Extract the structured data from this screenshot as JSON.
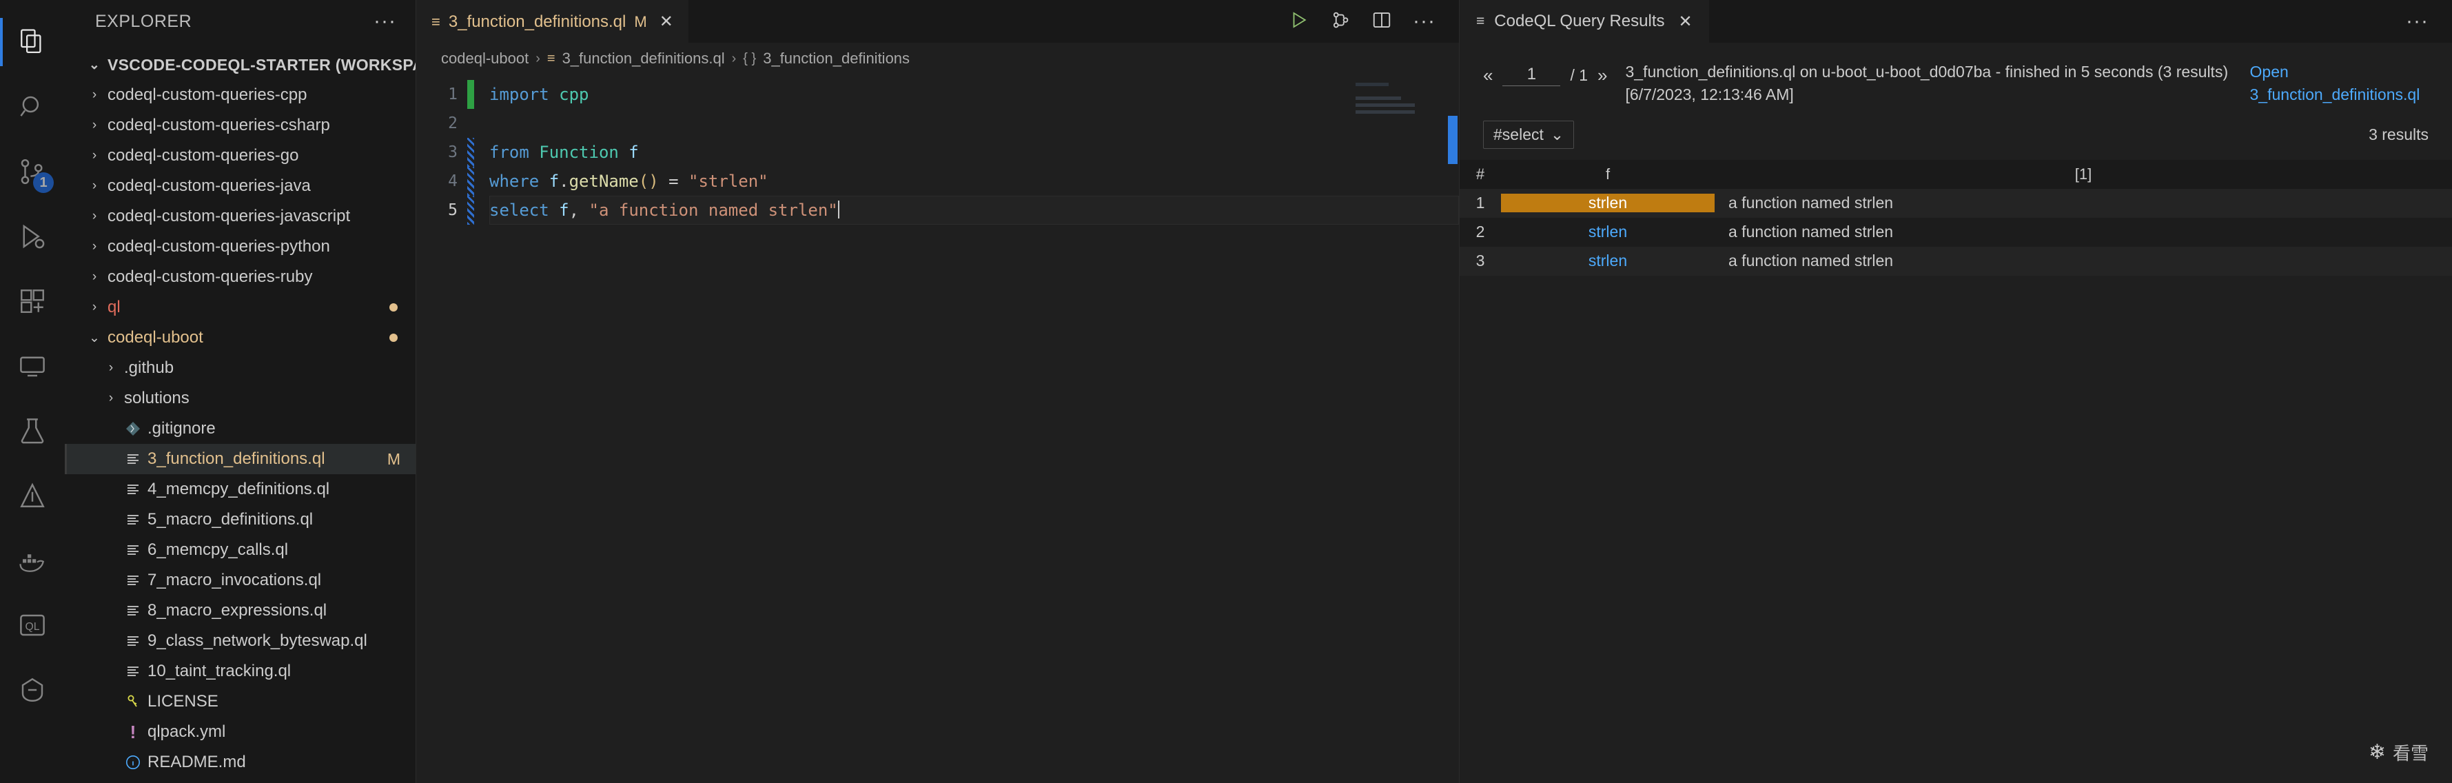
{
  "activity_bar": {
    "items": [
      {
        "name": "explorer",
        "icon": "files-icon",
        "active": true,
        "badge": null
      },
      {
        "name": "search",
        "icon": "search-icon",
        "active": false,
        "badge": null
      },
      {
        "name": "source-control",
        "icon": "source-control-icon",
        "active": false,
        "badge": "1"
      },
      {
        "name": "run-and-debug",
        "icon": "run-debug-icon",
        "active": false,
        "badge": null
      },
      {
        "name": "extensions",
        "icon": "extensions-icon",
        "active": false,
        "badge": null
      },
      {
        "name": "remote-explorer",
        "icon": "remote-explorer-icon",
        "active": false,
        "badge": null
      },
      {
        "name": "testing",
        "icon": "beaker-icon",
        "active": false,
        "badge": null
      },
      {
        "name": "vscode-pets",
        "icon": "triangle-icon",
        "active": false,
        "badge": null
      },
      {
        "name": "docker",
        "icon": "docker-icon",
        "active": false,
        "badge": null
      },
      {
        "name": "codeql",
        "icon": "ql-icon",
        "active": false,
        "badge": null
      },
      {
        "name": "copilot",
        "icon": "copilot-icon",
        "active": false,
        "badge": null
      }
    ]
  },
  "sidebar": {
    "title": "EXPLORER",
    "more_actions": "···",
    "root": {
      "label": "VSCODE-CODEQL-STARTER (WORKSPA...",
      "twisty": "⌄"
    },
    "items": [
      {
        "label": "codeql-custom-queries-cpp",
        "type": "folder",
        "twisty": "›",
        "color": "normal",
        "deco": "",
        "dot": false,
        "selected": false
      },
      {
        "label": "codeql-custom-queries-csharp",
        "type": "folder",
        "twisty": "›",
        "color": "normal",
        "deco": "",
        "dot": false,
        "selected": false
      },
      {
        "label": "codeql-custom-queries-go",
        "type": "folder",
        "twisty": "›",
        "color": "normal",
        "deco": "",
        "dot": false,
        "selected": false
      },
      {
        "label": "codeql-custom-queries-java",
        "type": "folder",
        "twisty": "›",
        "color": "normal",
        "deco": "",
        "dot": false,
        "selected": false
      },
      {
        "label": "codeql-custom-queries-javascript",
        "type": "folder",
        "twisty": "›",
        "color": "normal",
        "deco": "",
        "dot": false,
        "selected": false
      },
      {
        "label": "codeql-custom-queries-python",
        "type": "folder",
        "twisty": "›",
        "color": "normal",
        "deco": "",
        "dot": false,
        "selected": false
      },
      {
        "label": "codeql-custom-queries-ruby",
        "type": "folder",
        "twisty": "›",
        "color": "normal",
        "deco": "",
        "dot": false,
        "selected": false
      },
      {
        "label": "ql",
        "type": "folder",
        "twisty": "›",
        "color": "red",
        "deco": "",
        "dot": true,
        "selected": false
      },
      {
        "label": "codeql-uboot",
        "type": "folder",
        "twisty": "⌄",
        "color": "mod",
        "deco": "",
        "dot": true,
        "selected": false
      },
      {
        "label": ".github",
        "type": "folder",
        "twisty": "›",
        "color": "normal",
        "deco": "",
        "dot": false,
        "selected": false,
        "indent": 1
      },
      {
        "label": "solutions",
        "type": "folder",
        "twisty": "›",
        "color": "normal",
        "deco": "",
        "dot": false,
        "selected": false,
        "indent": 1
      },
      {
        "label": ".gitignore",
        "type": "git",
        "twisty": "",
        "color": "normal",
        "deco": "",
        "dot": false,
        "selected": false,
        "indent": 1
      },
      {
        "label": "3_function_definitions.ql",
        "type": "ql",
        "twisty": "",
        "color": "mod",
        "deco": "M",
        "dot": false,
        "selected": true,
        "indent": 1
      },
      {
        "label": "4_memcpy_definitions.ql",
        "type": "ql",
        "twisty": "",
        "color": "normal",
        "deco": "",
        "dot": false,
        "selected": false,
        "indent": 1
      },
      {
        "label": "5_macro_definitions.ql",
        "type": "ql",
        "twisty": "",
        "color": "normal",
        "deco": "",
        "dot": false,
        "selected": false,
        "indent": 1
      },
      {
        "label": "6_memcpy_calls.ql",
        "type": "ql",
        "twisty": "",
        "color": "normal",
        "deco": "",
        "dot": false,
        "selected": false,
        "indent": 1
      },
      {
        "label": "7_macro_invocations.ql",
        "type": "ql",
        "twisty": "",
        "color": "normal",
        "deco": "",
        "dot": false,
        "selected": false,
        "indent": 1
      },
      {
        "label": "8_macro_expressions.ql",
        "type": "ql",
        "twisty": "",
        "color": "normal",
        "deco": "",
        "dot": false,
        "selected": false,
        "indent": 1
      },
      {
        "label": "9_class_network_byteswap.ql",
        "type": "ql",
        "twisty": "",
        "color": "normal",
        "deco": "",
        "dot": false,
        "selected": false,
        "indent": 1
      },
      {
        "label": "10_taint_tracking.ql",
        "type": "ql",
        "twisty": "",
        "color": "normal",
        "deco": "",
        "dot": false,
        "selected": false,
        "indent": 1
      },
      {
        "label": "LICENSE",
        "type": "license",
        "twisty": "",
        "color": "normal",
        "deco": "",
        "dot": false,
        "selected": false,
        "indent": 1
      },
      {
        "label": "qlpack.yml",
        "type": "yml",
        "twisty": "",
        "color": "normal",
        "deco": "",
        "dot": false,
        "selected": false,
        "indent": 1
      },
      {
        "label": "README.md",
        "type": "md",
        "twisty": "",
        "color": "normal",
        "deco": "",
        "dot": false,
        "selected": false,
        "indent": 1
      }
    ]
  },
  "editor": {
    "tab": {
      "icon": "ql-file-icon",
      "label": "3_function_definitions.ql",
      "modified_badge": "M",
      "close": "✕"
    },
    "actions": [
      "run-query-icon",
      "quick-eval-icon",
      "split-editor-icon",
      "more-actions-icon"
    ],
    "breadcrumb": [
      {
        "label": "codeql-uboot",
        "icon": ""
      },
      {
        "label": "3_function_definitions.ql",
        "icon": "ql-file-icon"
      },
      {
        "label": "3_function_definitions",
        "icon": "braces-icon"
      }
    ],
    "breadcrumb_separator": "›",
    "line_numbers": [
      "1",
      "2",
      "3",
      "4",
      "5"
    ],
    "current_line": 5,
    "code": [
      {
        "n": 1,
        "change": "added",
        "tokens": [
          {
            "t": "import",
            "c": "k-import"
          },
          {
            "t": " ",
            "c": "k-op"
          },
          {
            "t": "cpp",
            "c": "k-mod2"
          }
        ]
      },
      {
        "n": 2,
        "change": "",
        "tokens": []
      },
      {
        "n": 3,
        "change": "modified",
        "tokens": [
          {
            "t": "from",
            "c": "k-kw"
          },
          {
            "t": " ",
            "c": "k-op"
          },
          {
            "t": "Function",
            "c": "k-type"
          },
          {
            "t": " ",
            "c": "k-op"
          },
          {
            "t": "f",
            "c": "k-var"
          }
        ]
      },
      {
        "n": 4,
        "change": "modified",
        "tokens": [
          {
            "t": "where",
            "c": "k-kw"
          },
          {
            "t": " ",
            "c": "k-op"
          },
          {
            "t": "f",
            "c": "k-var"
          },
          {
            "t": ".",
            "c": "k-op"
          },
          {
            "t": "getName",
            "c": "k-fn"
          },
          {
            "t": "()",
            "c": "k-paren"
          },
          {
            "t": " = ",
            "c": "k-op"
          },
          {
            "t": "\"strlen\"",
            "c": "k-str"
          }
        ]
      },
      {
        "n": 5,
        "change": "modified",
        "tokens": [
          {
            "t": "select",
            "c": "k-kw"
          },
          {
            "t": " ",
            "c": "k-op"
          },
          {
            "t": "f",
            "c": "k-var"
          },
          {
            "t": ", ",
            "c": "k-op"
          },
          {
            "t": "\"a function named strlen\"",
            "c": "k-str"
          }
        ]
      }
    ]
  },
  "results": {
    "tab": {
      "icon": "results-icon",
      "label": "CodeQL Query Results",
      "close": "✕"
    },
    "more_actions": "···",
    "pager": {
      "prev": "«",
      "next": "»",
      "current_page": "1",
      "total_pages": "/ 1"
    },
    "status_text": "3_function_definitions.ql on u-boot_u-boot_d0d07ba - finished in 5 seconds (3 results) [6/7/2023, 12:13:46 AM]",
    "open_link": {
      "line1": "Open",
      "line2": "3_function_definitions.ql"
    },
    "select_dropdown": {
      "label": "#select",
      "chevron": "⌄"
    },
    "result_count": "3 results",
    "columns": [
      "#",
      "f",
      "[1]"
    ],
    "rows": [
      {
        "index": "1",
        "f": "strlen",
        "col1": "a function named strlen",
        "selected": true
      },
      {
        "index": "2",
        "f": "strlen",
        "col1": "a function named strlen",
        "selected": false
      },
      {
        "index": "3",
        "f": "strlen",
        "col1": "a function named strlen",
        "selected": false
      }
    ]
  },
  "watermark": {
    "icon": "snowflake-icon",
    "text": "看雪"
  },
  "colors": {
    "accent": "#2f7de1",
    "modified": "#e2c08d",
    "link": "#4daafc",
    "selection_highlight": "#bf7c11",
    "badge": "#1f6feb",
    "folder_red": "#e06c5c"
  }
}
